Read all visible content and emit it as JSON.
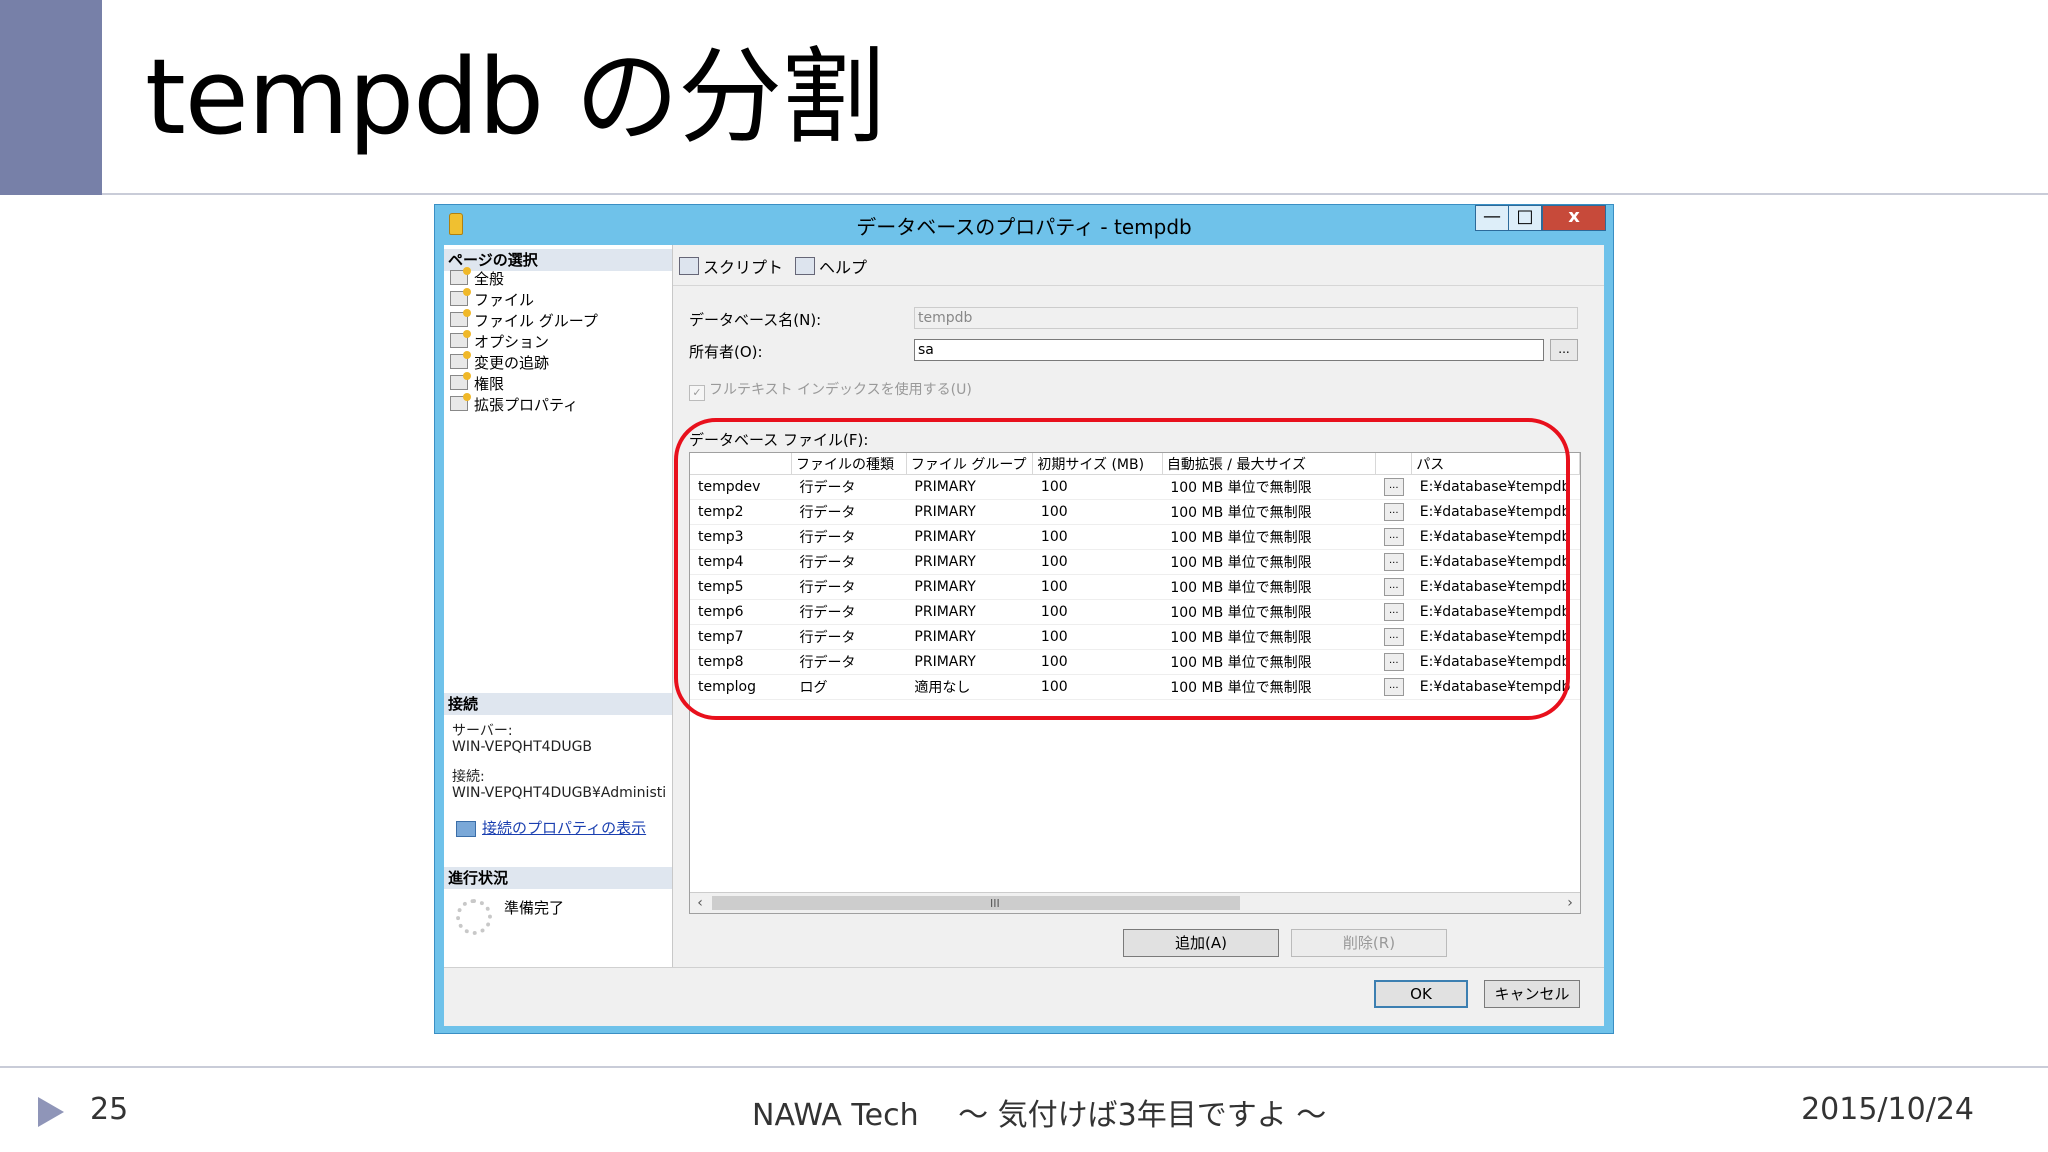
{
  "slide": {
    "title": "tempdb の分割",
    "page_number": "25",
    "footer_center": "NAWA Tech　 ～ 気付けば3年目ですよ ～",
    "date": "2015/10/24",
    "accent_color": "#7780a8"
  },
  "dialog": {
    "title": "データベースのプロパティ - tempdb",
    "window_buttons": {
      "minimize": "—",
      "maximize": "□",
      "close": "x"
    },
    "left_pane": {
      "select_page_header": "ページの選択",
      "pages": [
        "全般",
        "ファイル",
        "ファイル グループ",
        "オプション",
        "変更の追跡",
        "権限",
        "拡張プロパティ"
      ],
      "connection_header": "接続",
      "server_label": "サーバー:",
      "server_value": "WIN-VEPQHT4DUGB",
      "connection_label": "接続:",
      "connection_value": "WIN-VEPQHT4DUGB¥Administi",
      "view_connection_link": "接続のプロパティの表示",
      "progress_header": "進行状況",
      "progress_status": "準備完了"
    },
    "toolbar": {
      "script": "スクリプト",
      "help": "ヘルプ"
    },
    "db_name_label": "データベース名(N):",
    "db_name_value": "tempdb",
    "owner_label": "所有者(O):",
    "owner_value": "sa",
    "ellipsis": "...",
    "fulltext_checkbox": "フルテキスト インデックスを使用する(U)",
    "files_label": "データベース ファイル(F):",
    "columns": [
      "",
      "ファイルの種類",
      "ファイル グループ",
      "初期サイズ (MB)",
      "自動拡張 / 最大サイズ",
      "",
      "パス"
    ],
    "files": [
      [
        "tempdev",
        "行データ",
        "PRIMARY",
        "100",
        "100 MB 単位で無制限",
        "E:¥database¥tempdb"
      ],
      [
        "temp2",
        "行データ",
        "PRIMARY",
        "100",
        "100 MB 単位で無制限",
        "E:¥database¥tempdb"
      ],
      [
        "temp3",
        "行データ",
        "PRIMARY",
        "100",
        "100 MB 単位で無制限",
        "E:¥database¥tempdb"
      ],
      [
        "temp4",
        "行データ",
        "PRIMARY",
        "100",
        "100 MB 単位で無制限",
        "E:¥database¥tempdb"
      ],
      [
        "temp5",
        "行データ",
        "PRIMARY",
        "100",
        "100 MB 単位で無制限",
        "E:¥database¥tempdb"
      ],
      [
        "temp6",
        "行データ",
        "PRIMARY",
        "100",
        "100 MB 単位で無制限",
        "E:¥database¥tempdb"
      ],
      [
        "temp7",
        "行データ",
        "PRIMARY",
        "100",
        "100 MB 単位で無制限",
        "E:¥database¥tempdb"
      ],
      [
        "temp8",
        "行データ",
        "PRIMARY",
        "100",
        "100 MB 単位で無制限",
        "E:¥database¥tempdb"
      ],
      [
        "templog",
        "ログ",
        "適用なし",
        "100",
        "100 MB 単位で無制限",
        "E:¥database¥tempdb"
      ]
    ],
    "buttons": {
      "add": "追加(A)",
      "remove": "削除(R)",
      "ok": "OK",
      "cancel": "キャンセル"
    },
    "scroll_grip": "III",
    "highlight_color": "#e8101c"
  }
}
